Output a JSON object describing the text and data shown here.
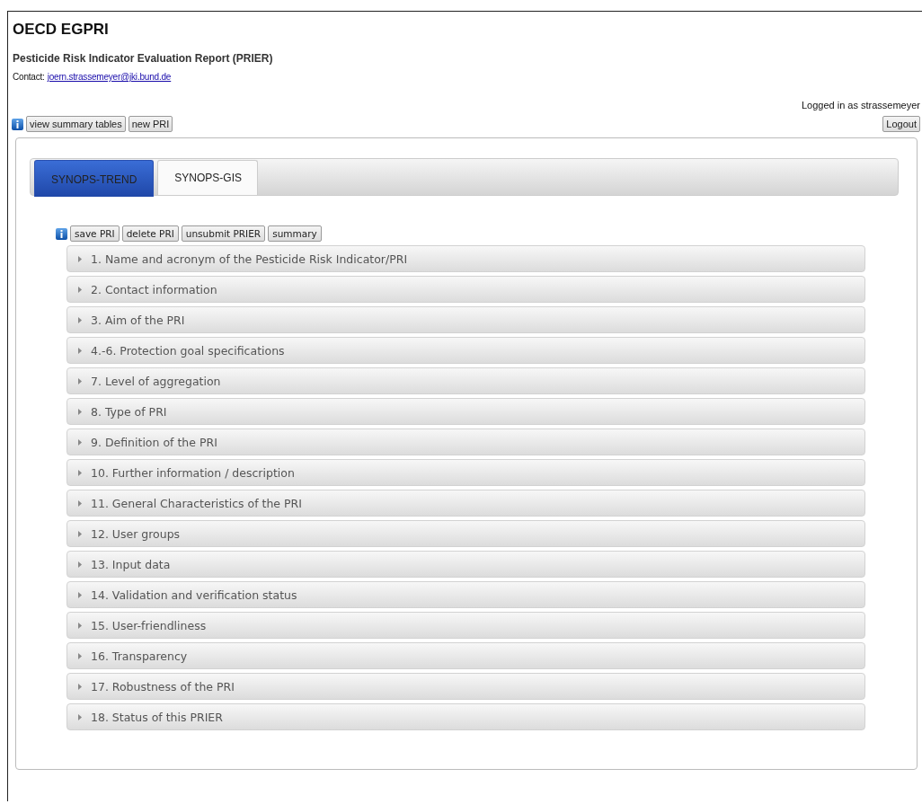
{
  "header": {
    "title": "OECD EGPRI",
    "subtitle": "Pesticide Risk Indicator Evaluation Report (PRIER)",
    "contact_label": "Contact:",
    "contact_email": "joern.strassemeyer@jki.bund.de",
    "login_status": "Logged in as strassemeyer"
  },
  "top_toolbar": {
    "buttons": [
      "view summary tables",
      "new PRI"
    ],
    "logout": "Logout"
  },
  "tabs": [
    {
      "label": "SYNOPS-TREND",
      "selected": true
    },
    {
      "label": "SYNOPS-GIS",
      "selected": false
    }
  ],
  "form_toolbar": {
    "buttons": [
      "save PRI",
      "delete PRI",
      "unsubmit PRIER",
      "summary"
    ]
  },
  "sections": [
    {
      "title": "1. Name and acronym of the Pesticide Risk Indicator/PRI",
      "expanded": false
    },
    {
      "title": "2. Contact information",
      "expanded": false
    },
    {
      "title": "3. Aim of the PRI",
      "expanded": false
    },
    {
      "title": "4.-6. Protection goal specifications",
      "expanded": false
    },
    {
      "title": "7. Level of aggregation",
      "expanded": false
    },
    {
      "title": "8. Type of PRI",
      "expanded": false
    },
    {
      "title": "9. Definition of the PRI",
      "expanded": false
    },
    {
      "title": "10. Further information / description",
      "expanded": false
    },
    {
      "title": "11. General Characteristics of the PRI",
      "expanded": false
    },
    {
      "title": "12. User groups",
      "expanded": false
    },
    {
      "title": "13. Input data",
      "expanded": false
    },
    {
      "title": "14. Validation and verification status",
      "expanded": false
    },
    {
      "title": "15. User-friendliness",
      "expanded": false
    },
    {
      "title": "16. Transparency",
      "expanded": false
    },
    {
      "title": "17. Robustness of the PRI",
      "expanded": false
    },
    {
      "title": "18. Status of this PRIER",
      "expanded": false
    }
  ]
}
